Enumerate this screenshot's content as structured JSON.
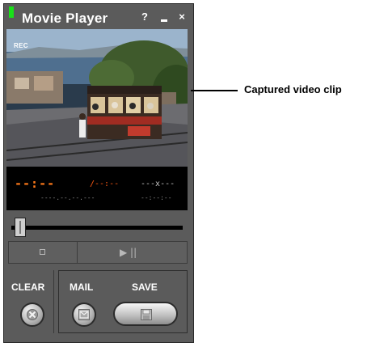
{
  "window": {
    "title": "Movie Player",
    "help_label": "?",
    "close_label": "×"
  },
  "video": {
    "rec_label": "REC"
  },
  "lcd": {
    "main_readout": "--:--",
    "mid_readout": "/--:--",
    "right_readout": "---x---",
    "sub_readout_left": "----.--.--.---",
    "sub_readout_right": "--:--:--"
  },
  "transport": {
    "stop_icon": "stop-icon",
    "play_pause_icon": "play-pause-icon",
    "play_pause_glyph": "▶ ||"
  },
  "seek": {
    "position_fraction": 0.0
  },
  "buttons": {
    "clear_label": "CLEAR",
    "mail_label": "MAIL",
    "save_label": "SAVE"
  },
  "annotation": {
    "callout_text": "Captured video clip"
  },
  "colors": {
    "window_bg": "#5b5b5b",
    "led": "#19e019",
    "lcd_accent": "#ff7a1a"
  }
}
